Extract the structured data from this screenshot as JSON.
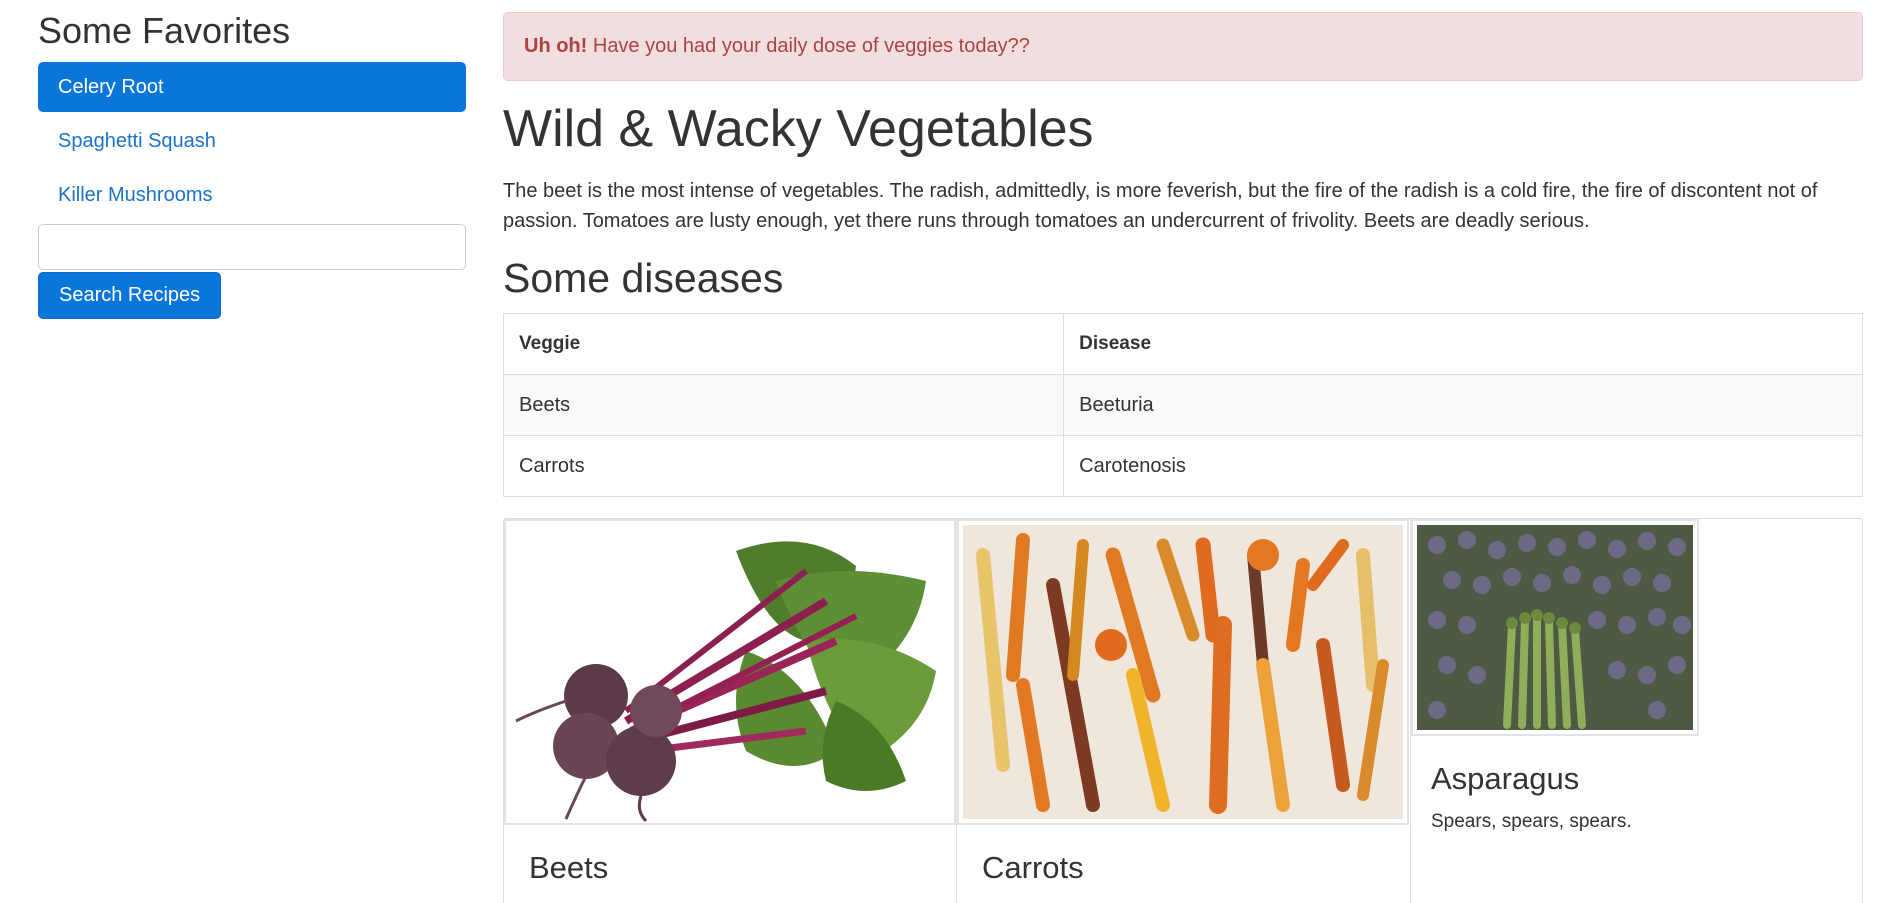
{
  "sidebar": {
    "title": "Some Favorites",
    "items": [
      {
        "label": "Celery Root"
      },
      {
        "label": "Spaghetti Squash"
      },
      {
        "label": "Killer Mushrooms"
      }
    ],
    "search": {
      "value": "",
      "placeholder": ""
    },
    "search_button": "Search Recipes"
  },
  "alert": {
    "strong": "Uh oh!",
    "text": " Have you had your daily dose of veggies today??"
  },
  "main": {
    "title": "Wild & Wacky Vegetables",
    "paragraph": "The beet is the most intense of vegetables. The radish, admittedly, is more feverish, but the fire of the radish is a cold fire, the fire of discontent not of passion. Tomatoes are lusty enough, yet there runs through tomatoes an undercurrent of frivolity. Beets are deadly serious.",
    "diseases_title": "Some diseases",
    "table": {
      "headers": [
        "Veggie",
        "Disease"
      ],
      "rows": [
        [
          "Beets",
          "Beeturia"
        ],
        [
          "Carrots",
          "Carotenosis"
        ]
      ]
    },
    "cards": [
      {
        "name": "Beets",
        "image": "beets-photo"
      },
      {
        "name": "Carrots",
        "image": "carrots-photo"
      },
      {
        "name": "Asparagus",
        "image": "asparagus-photo",
        "description": "Spears, spears, spears."
      }
    ]
  },
  "colors": {
    "primary": "#0b76da",
    "alert_bg": "#f2dede",
    "alert_text": "#a94442"
  }
}
